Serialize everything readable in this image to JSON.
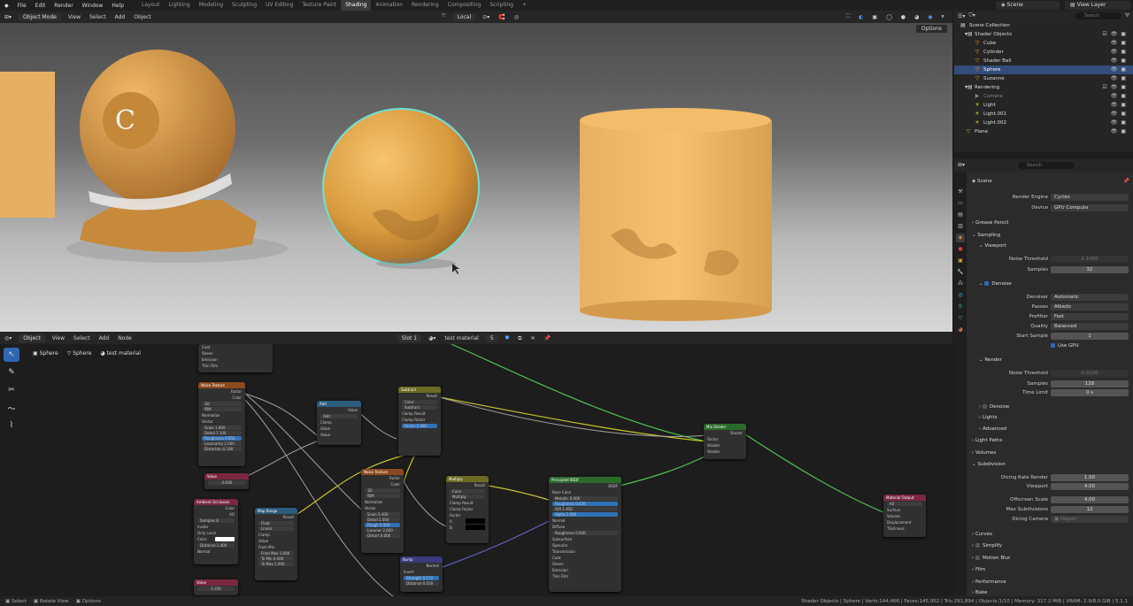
{
  "topbar": {
    "menus": [
      "File",
      "Edit",
      "Render",
      "Window",
      "Help"
    ],
    "workspaces": [
      "Layout",
      "Modeling",
      "Sculpting",
      "UV Editing",
      "Texture Paint",
      "Shading",
      "Animation",
      "Rendering",
      "Compositing",
      "Scripting"
    ],
    "scene": "Scene",
    "view_layer": "View Layer"
  },
  "top_workspace_labels": [
    "Layout",
    "Lighting",
    "Modeling",
    "Sculpting",
    "UV Editing",
    "Texture Paint",
    "Shading",
    "Animation",
    "Rendering",
    "Compositing",
    "Scripting"
  ],
  "viewport_header": {
    "mode": "Object Mode",
    "menus": [
      "View",
      "Select",
      "Add",
      "Object"
    ],
    "transform": "Local",
    "options": "Options"
  },
  "node_header": {
    "editor": "Object",
    "menus": [
      "View",
      "Select",
      "Add",
      "Node"
    ],
    "slot": "Slot 1",
    "material": "test material",
    "users": "5"
  },
  "breadcrumb": [
    "Sphere",
    "Sphere",
    "test material"
  ],
  "nodes": {
    "noise1": {
      "title": "Noise Texture",
      "out1": "Factor",
      "out2": "Color",
      "dim": "3D",
      "type": "fBM",
      "normalize": "Normalize",
      "vector": "Vector",
      "scale": "Scale    1.900",
      "detail": "Detail   7.100",
      "rough": "Roughness 0.650",
      "lac": "Lacunarity 2.000",
      "dist": "Distortion 0.180"
    },
    "add": {
      "title": "Add",
      "out": "Value",
      "op": "Add",
      "clamp": "Clamp",
      "v1": "Value",
      "v2": "Value"
    },
    "subtract": {
      "title": "Subtract",
      "out": "Result",
      "type": "Color",
      "op": "Subtract",
      "clampres": "Clamp Result",
      "clampfac": "Clamp Factor",
      "factor": "Factor   1.000"
    },
    "value1": {
      "title": "Value",
      "val": "-0.040"
    },
    "ao": {
      "title": "Ambient Occlusion",
      "out1": "Color",
      "out2": "AO",
      "samples": "Samples   8",
      "inside": "Inside",
      "onlylocal": "Only Local",
      "color": "Color",
      "dist": "Distance  1.000",
      "normal": "Normal"
    },
    "maprange": {
      "title": "Map Range",
      "out": "Result",
      "type": "Float",
      "interp": "Linear",
      "clamp": "Clamp",
      "value": "Value",
      "fmin": "From Min",
      "fmax": "From Max  1.000",
      "tmin": "To Min    0.000",
      "tmax": "To Max    1.000"
    },
    "noise2": {
      "title": "Noise Texture",
      "out1": "Factor",
      "out2": "Color",
      "dim": "3D",
      "type": "fBM",
      "normalize": "Normalize",
      "vector": "Vector",
      "scale": "Scale    5.400",
      "detail": "Detail   2.000",
      "rough": "Rough    0.500",
      "lac": "Lacunar  2.000",
      "dist": "Distort  0.000"
    },
    "multiply": {
      "title": "Multiply",
      "out": "Result",
      "type": "Color",
      "op": "Multiply",
      "clampres": "Clamp Result",
      "clampfac": "Clamp Factor",
      "factor": "Factor",
      "a": "A",
      "b": "B"
    },
    "bump": {
      "title": "Bump",
      "out": "Normal",
      "invert": "Invert",
      "strength": "Strength  0.170",
      "dist": "Distance  0.030"
    },
    "value2": {
      "title": "Value",
      "val": "0.350"
    },
    "bsdf": {
      "title": "Principled BSDF",
      "out": "BSDF",
      "basecolor": "Base Color",
      "metallic": "Metallic   0.000",
      "rough": "Roughness  0.430",
      "ior": "IOR        1.450",
      "alpha": "Alpha      1.000",
      "normal": "Normal",
      "diffuse": "Diffuse",
      "diffrough": "Roughness  0.000",
      "sub": "Subsurface",
      "spec": "Specular",
      "trans": "Transmission",
      "coat": "Coat",
      "sheen": "Sheen",
      "emission": "Emission",
      "thin": "Thin Film"
    },
    "mixshader": {
      "title": "Mix Shader",
      "out": "Shader",
      "fac": "Factor",
      "s1": "Shader",
      "s2": "Shader"
    },
    "output": {
      "title": "Material Output",
      "target": "All",
      "surface": "Surface",
      "volume": "Volume",
      "disp": "Displacement",
      "thick": "Thickness"
    },
    "topnode": {
      "items": [
        "Coat",
        "Sheen",
        "Emission",
        "Thin Film"
      ]
    }
  },
  "outliner": {
    "search": "Search",
    "collection": "Scene Collection",
    "rows": [
      {
        "label": "Shader Objects"
      },
      {
        "label": "Cube"
      },
      {
        "label": "Cylinder"
      },
      {
        "label": "Shader Ball"
      },
      {
        "label": "Sphere"
      },
      {
        "label": "Suzanne"
      },
      {
        "label": "Rendering"
      },
      {
        "label": "Camera"
      },
      {
        "label": "Light"
      },
      {
        "label": "Light.001"
      },
      {
        "label": "Light.002"
      },
      {
        "label": "Plane"
      }
    ]
  },
  "properties": {
    "search": "Search",
    "scene": "Scene",
    "render_engine_label": "Render Engine",
    "render_engine": "Cycles",
    "device_label": "Device",
    "device": "GPU Compute",
    "grease_pencil": "Grease Pencil",
    "sampling": "Sampling",
    "viewport": "Viewport",
    "noise_threshold_label": "Noise Threshold",
    "vp_noise_threshold": "0.1000",
    "samples_label": "Samples",
    "vp_samples": "32",
    "denoise": "Denoise",
    "denoiser_label": "Denoiser",
    "denoiser": "Automatic",
    "passes_label": "Passes",
    "passes": "Albedo",
    "prefilter_label": "Prefilter",
    "prefilter": "Fast",
    "quality_label": "Quality",
    "quality": "Balanced",
    "start_sample_label": "Start Sample",
    "start_sample": "1",
    "use_gpu": "Use GPU",
    "render": "Render",
    "r_noise_threshold": "0.0100",
    "r_samples": "128",
    "time_limit_label": "Time Limit",
    "time_limit": "0 s",
    "r_denoise": "Denoise",
    "lights": "Lights",
    "advanced": "Advanced",
    "light_paths": "Light Paths",
    "volumes": "Volumes",
    "subdivision": "Subdivision",
    "dicing_render_label": "Dicing Rate Render",
    "dicing_render": "1.00",
    "sub_viewport_label": "Viewport",
    "sub_viewport": "4.00",
    "offscreen_label": "Offscreen Scale",
    "offscreen": "4.00",
    "max_sub_label": "Max Subdivisions",
    "max_sub": "12",
    "dicing_cam_label": "Dicing Camera",
    "dicing_cam": "Object",
    "curves": "Curves",
    "simplify": "Simplify",
    "motion_blur": "Motion Blur",
    "film": "Film",
    "performance": "Performance",
    "bake": "Bake"
  },
  "statusbar": {
    "left1": "Select",
    "left2": "Rotate View",
    "left3": "Options",
    "stats": "Shader Objects | Sphere | Verts:144,466 | Faces:145,952 | Tris:291,894 | Objects:1/10 | Memory: 317.2 MiB | VRAM: 2.9/8.0 GiB | 5.1.1"
  },
  "colors": {
    "accent": "#2f67b3",
    "selection": "#6ee0d8",
    "material": "#e5a84f",
    "socket_yellow": "#c7c229",
    "socket_green": "#4fbf4f",
    "socket_gray": "#a1a1a1",
    "socket_purple": "#6363c7"
  }
}
